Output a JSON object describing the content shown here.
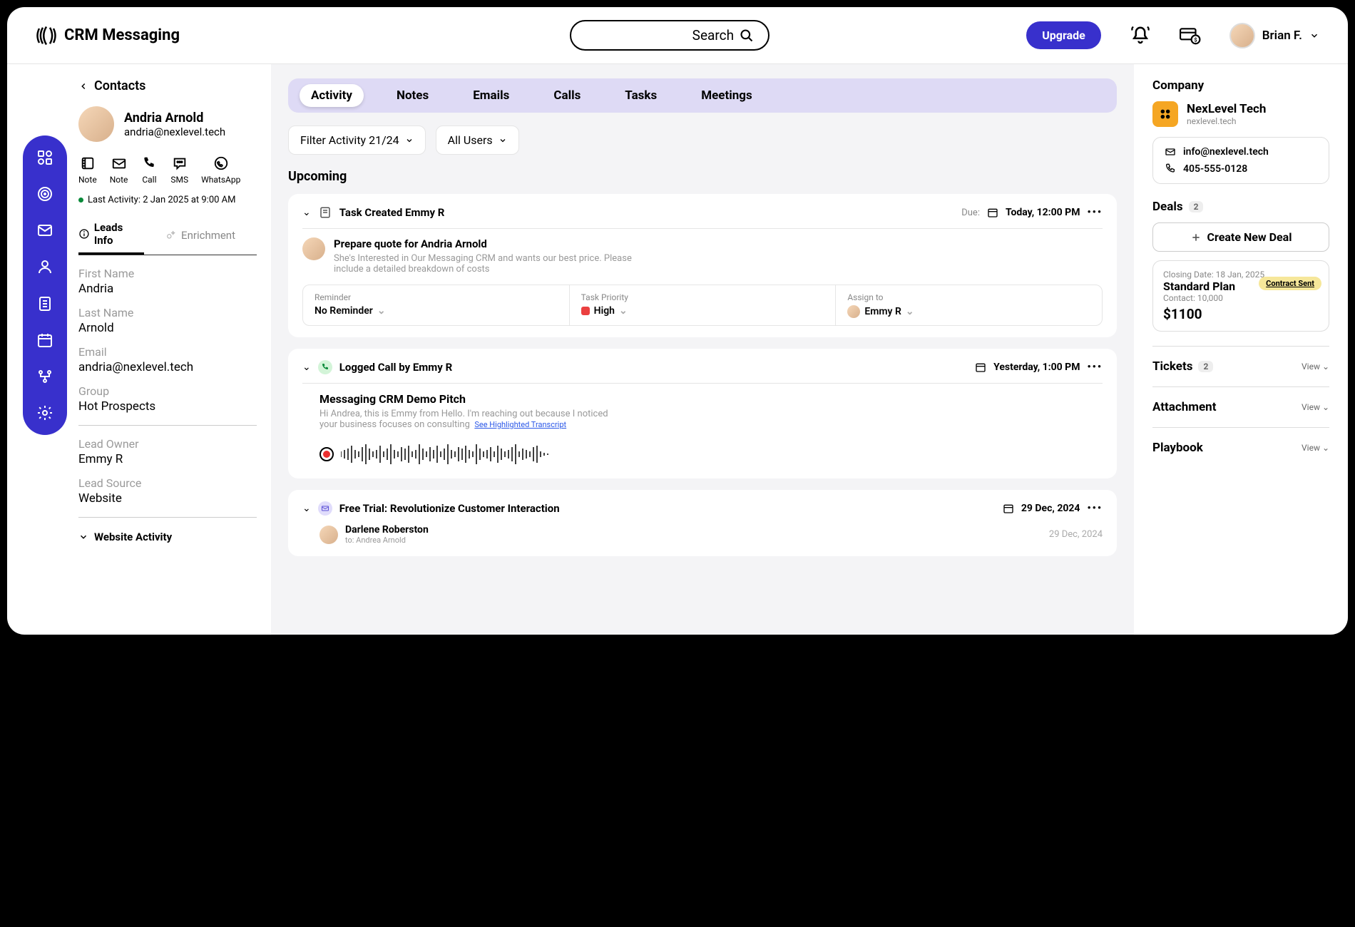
{
  "brand": "CRM Messaging",
  "search": {
    "placeholder": "Search"
  },
  "upgrade": "Upgrade",
  "user": {
    "name": "Brian F."
  },
  "breadcrumb": "Contacts",
  "contact": {
    "name": "Andria  Arnold",
    "email": "andria@nexlevel.tech"
  },
  "actions": [
    {
      "id": "note",
      "label": "Note"
    },
    {
      "id": "note2",
      "label": "Note"
    },
    {
      "id": "call",
      "label": "Call"
    },
    {
      "id": "sms",
      "label": "SMS"
    },
    {
      "id": "whatsapp",
      "label": "WhatsApp"
    }
  ],
  "last_activity": "Last Activity: 2 Jan 2025 at 9:00 AM",
  "info_tabs": {
    "leads": "Leads Info",
    "enrichment": "Enrichment"
  },
  "fields": {
    "first_name_label": "First Name",
    "first_name": "Andria",
    "last_name_label": "Last Name",
    "last_name": "Arnold",
    "email_label": "Email",
    "email": "andria@nexlevel.tech",
    "group_label": "Group",
    "group": "Hot Prospects",
    "owner_label": "Lead Owner",
    "owner": "Emmy R",
    "source_label": "Lead Source",
    "source": "Website"
  },
  "website_activity": "Website Activity",
  "main_tabs": [
    "Activity",
    "Notes",
    "Emails",
    "Calls",
    "Tasks",
    "Meetings"
  ],
  "filters": {
    "activity": "Filter Activity 21/24",
    "users": "All Users"
  },
  "upcoming": "Upcoming",
  "task_card": {
    "title": "Task Created Emmy R",
    "due_label": "Due:",
    "due": "Today, 12:00 PM",
    "task_title": "Prepare quote for Andria Arnold",
    "task_desc": "She's Interested in Our Messaging CRM and wants our best price. Please include a detailed breakdown of costs",
    "reminder_label": "Reminder",
    "reminder": "No Reminder",
    "priority_label": "Task Priority",
    "priority": "High",
    "assign_label": "Assign to",
    "assign": "Emmy R"
  },
  "call_card": {
    "title": "Logged Call by Emmy R",
    "date": "Yesterday, 1:00 PM",
    "subject": "Messaging CRM Demo Pitch",
    "desc": "Hi Andrea, this is Emmy from Hello. I'm reaching out because I noticed your business focuses on consulting",
    "transcript": "See Highlighted Transcript"
  },
  "email_card": {
    "title": "Free Trial: Revolutionize Customer Interaction",
    "date": "29 Dec, 2024",
    "sender": "Darlene Roberston",
    "to": "to: Andrea Arnold",
    "sent": "29 Dec, 2024"
  },
  "company": {
    "label": "Company",
    "name": "NexLevel Tech",
    "web": "nexlevel.tech",
    "email": "info@nexlevel.tech",
    "phone": "405-555-0128"
  },
  "deals": {
    "label": "Deals",
    "count": "2",
    "new": "Create New Deal",
    "closing_date": "Closing Date: 18 Jan, 2025",
    "plan": "Standard Plan",
    "contact": "Contact: 10,000",
    "amount": "$1100",
    "status": "Contract Sent"
  },
  "tickets": {
    "label": "Tickets",
    "count": "2",
    "view": "View"
  },
  "attachment": {
    "label": "Attachment",
    "view": "View"
  },
  "playbook": {
    "label": "Playbook",
    "view": "View"
  }
}
